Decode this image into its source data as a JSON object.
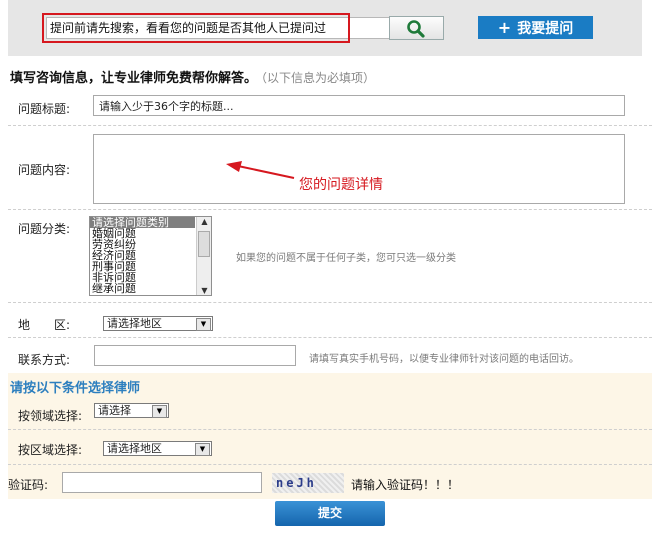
{
  "search": {
    "value": "提问前请先搜索，看看您的问题是否其他人已提问过"
  },
  "ask_button": {
    "icon": "+",
    "label": "我要提问"
  },
  "heading": {
    "main": "填写咨询信息，让专业律师免费帮你解答。",
    "note": "（以下信息为必填项）"
  },
  "title_field": {
    "label": "问题标题:",
    "value": "请输入少于36个字的标题..."
  },
  "content_field": {
    "label": "问题内容:",
    "annotation": "您的问题详情"
  },
  "category": {
    "label": "问题分类:",
    "options": [
      "请选择问题类别",
      "婚姻问题",
      "劳资纠纷",
      "经济问题",
      "刑事问题",
      "非诉问题",
      "继承问题"
    ],
    "hint": "如果您的问题不属于任何子类，您可只选一级分类"
  },
  "region": {
    "label": "地　　区:",
    "selected": "请选择地区"
  },
  "contact": {
    "label": "联系方式:",
    "hint": "请填写真实手机号码，以便专业律师针对该问题的电话回访。"
  },
  "lawyer_section": {
    "title": "请按以下条件选择律师",
    "by_field_label": "按领域选择:",
    "by_field_selected": "请选择",
    "by_region_label": "按区域选择:",
    "by_region_selected": "请选择地区"
  },
  "captcha": {
    "label": "验证码:",
    "image_text": "neJh",
    "prompt": "请输入验证码！！！"
  },
  "submit_label": "提交",
  "colors": {
    "accent": "#1a7cc4",
    "highlight_box": "#d6181f",
    "arrow": "#d6181f",
    "section_bg": "#fdf6e7"
  }
}
